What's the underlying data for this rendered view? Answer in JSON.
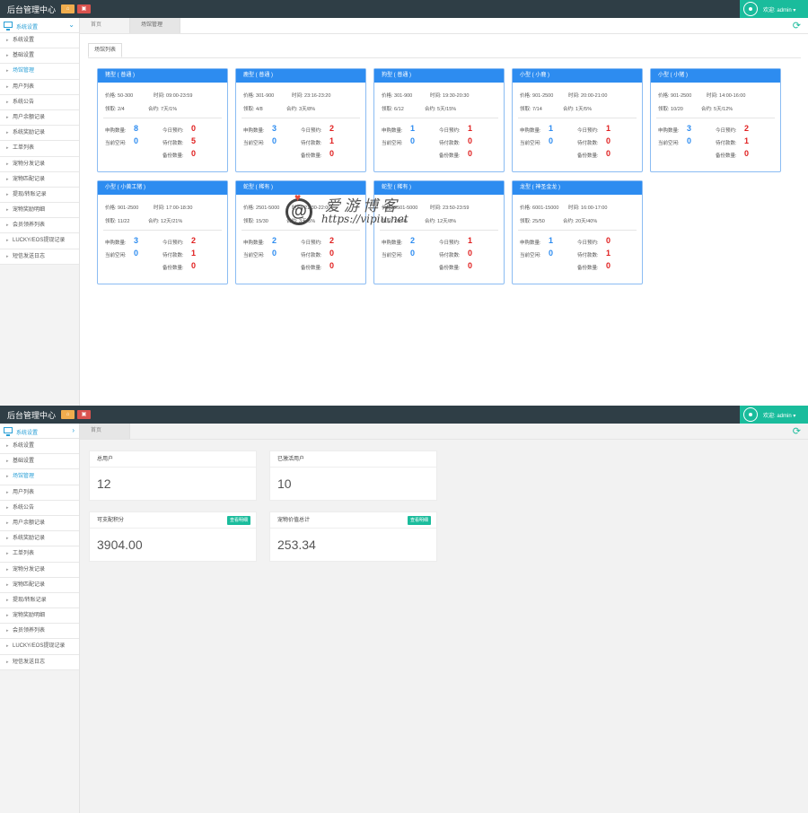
{
  "app": {
    "title": "后台管理中心",
    "welcome": "欢迎: admin ▾"
  },
  "sidebar": {
    "header": "系统设置",
    "items": [
      "系统设置",
      "基础设置",
      "场馆管理",
      "用户列表",
      "系统公告",
      "用户余额记录",
      "系统奖励记录",
      "工单列表",
      "宠物分发记录",
      "宠物匹配记录",
      "提现/转账记录",
      "宠物奖励明细",
      "会员领养列表",
      "LUCKY/EOS提现记录",
      "短信发送日志"
    ],
    "active_index_panel1": 2,
    "active_index_panel2": 2
  },
  "tabs_panel1": [
    "首页",
    "场馆管理"
  ],
  "tabs_panel2": [
    "首页"
  ],
  "subtab": "场馆列表",
  "cards": [
    {
      "title": "猪型 ( 普通 )",
      "price": "价格: 50-300",
      "time": "时间: 09:00-23:59",
      "claim": "领取: 2/4",
      "contract": "合约: 7天/1%",
      "c1": "8",
      "c2": "0",
      "c3": "0",
      "c4": "5",
      "c5": "0"
    },
    {
      "title": "鹿型 ( 普通 )",
      "price": "价格: 301-900",
      "time": "时间: 23:16-23:20",
      "claim": "领取: 4/8",
      "contract": "合约: 3天/8%",
      "c1": "3",
      "c2": "0",
      "c3": "2",
      "c4": "1",
      "c5": "0"
    },
    {
      "title": "狗型 ( 普通 )",
      "price": "价格: 301-900",
      "time": "时间: 19:30-20:30",
      "claim": "领取: 6/12",
      "contract": "合约: 5天/15%",
      "c1": "1",
      "c2": "0",
      "c3": "1",
      "c4": "0",
      "c5": "0"
    },
    {
      "title": "小型 ( 小鹿 )",
      "price": "价格: 901-2500",
      "time": "时间: 20:00-21:00",
      "claim": "领取: 7/14",
      "contract": "合约: 1天/5%",
      "c1": "1",
      "c2": "0",
      "c3": "1",
      "c4": "0",
      "c5": "0"
    },
    {
      "title": "小型 ( 小猪 )",
      "price": "价格: 901-2500",
      "time": "时间: 14:00-16:00",
      "claim": "领取: 10/20",
      "contract": "合约: 5天/12%",
      "c1": "3",
      "c2": "0",
      "c3": "2",
      "c4": "1",
      "c5": "0"
    },
    {
      "title": "小型 ( 小黄工猪 )",
      "price": "价格: 901-2500",
      "time": "时间: 17:00-18:30",
      "claim": "领取: 11/22",
      "contract": "合约: 12天/21%",
      "c1": "3",
      "c2": "0",
      "c3": "2",
      "c4": "1",
      "c5": "0"
    },
    {
      "title": "蛇型 ( 稀有 )",
      "price": "价格: 2501-5000",
      "time": "时间: 21:30-22:00",
      "claim": "领取: 15/30",
      "contract": "合约: 3天/5%",
      "c1": "2",
      "c2": "0",
      "c3": "2",
      "c4": "0",
      "c5": "0"
    },
    {
      "title": "蛇型 ( 稀有 )",
      "price": "价格: 2501-5000",
      "time": "时间: 23:50-23:59",
      "claim": "领取: 20/40",
      "contract": "合约: 12天/8%",
      "c1": "2",
      "c2": "0",
      "c3": "1",
      "c4": "0",
      "c5": "0"
    },
    {
      "title": "龙型 ( 神圣金龙 )",
      "price": "价格: 6001-15000",
      "time": "时间: 16:00-17:00",
      "claim": "领取: 25/50",
      "contract": "合约: 20天/40%",
      "c1": "1",
      "c2": "0",
      "c3": "0",
      "c4": "1",
      "c5": "0"
    }
  ],
  "card_labels": {
    "l1": "申购数量:",
    "l2": "当前空闲:",
    "l3": "今日预约:",
    "l4": "待付款数:",
    "l5": "备份数量:"
  },
  "watermark": {
    "cn": "爱游博客",
    "url": "https://vipiu.net"
  },
  "stats": [
    {
      "title": "总用户",
      "value": "12",
      "button": ""
    },
    {
      "title": "已激活用户",
      "value": "10",
      "button": ""
    },
    {
      "title": "可支配积分",
      "value": "3904.00",
      "button": "查看明细"
    },
    {
      "title": "宠物价值总计",
      "value": "253.34",
      "button": "查看明细"
    }
  ]
}
